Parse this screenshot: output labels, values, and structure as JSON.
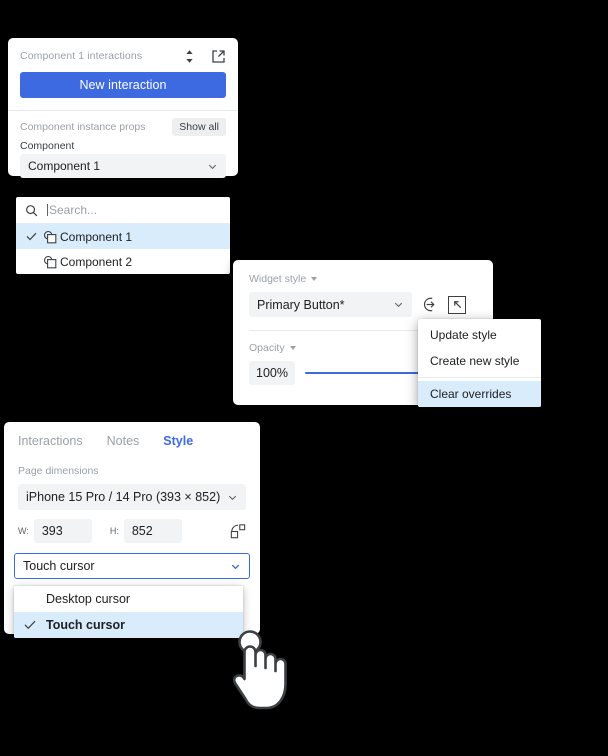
{
  "background_color": "#000000",
  "accent_color": "#3e6ae1",
  "highlight_color": "#d9ecfb",
  "interactions_panel": {
    "title": "Component 1 interactions",
    "icons": {
      "stepper": "chevron-up-down-icon",
      "open": "open-external-icon"
    },
    "new_interaction_label": "New interaction",
    "props_label": "Component instance props",
    "show_all_label": "Show all",
    "component_field_label": "Component",
    "component_selected": "Component 1",
    "dropdown": {
      "search_placeholder": "Search...",
      "search_value": "",
      "search_icon": "search-icon",
      "options": [
        {
          "label": "Component 1",
          "selected": true
        },
        {
          "label": "Component 2",
          "selected": false
        }
      ]
    }
  },
  "widget_panel": {
    "style_label": "Widget style",
    "style_selected": "Primary Button*",
    "apply_icon": "arrow-into-circle-icon",
    "detach_icon": "scale-corner-icon",
    "opacity_label": "Opacity",
    "opacity_value": "100%",
    "opacity_percent": 100,
    "menu": {
      "items": [
        {
          "label": "Update style",
          "highlighted": false
        },
        {
          "label": "Create new style",
          "highlighted": false
        },
        {
          "label": "Clear overrides",
          "highlighted": true
        }
      ]
    }
  },
  "style_panel": {
    "tabs": [
      {
        "label": "Interactions",
        "active": false
      },
      {
        "label": "Notes",
        "active": false
      },
      {
        "label": "Style",
        "active": true
      }
    ],
    "page_dimensions_label": "Page dimensions",
    "preset_selected": "iPhone 15 Pro / 14 Pro  (393 × 852)",
    "width_tag": "W:",
    "width_value": "393",
    "height_tag": "H:",
    "height_value": "852",
    "swap_icon": "rotate-dimensions-icon",
    "cursor_selected": "Touch cursor",
    "cursor_options": [
      {
        "label": "Desktop cursor",
        "selected": false
      },
      {
        "label": "Touch cursor",
        "selected": true
      }
    ]
  },
  "pointer": {
    "icon": "touch-tap-hand-cursor"
  }
}
